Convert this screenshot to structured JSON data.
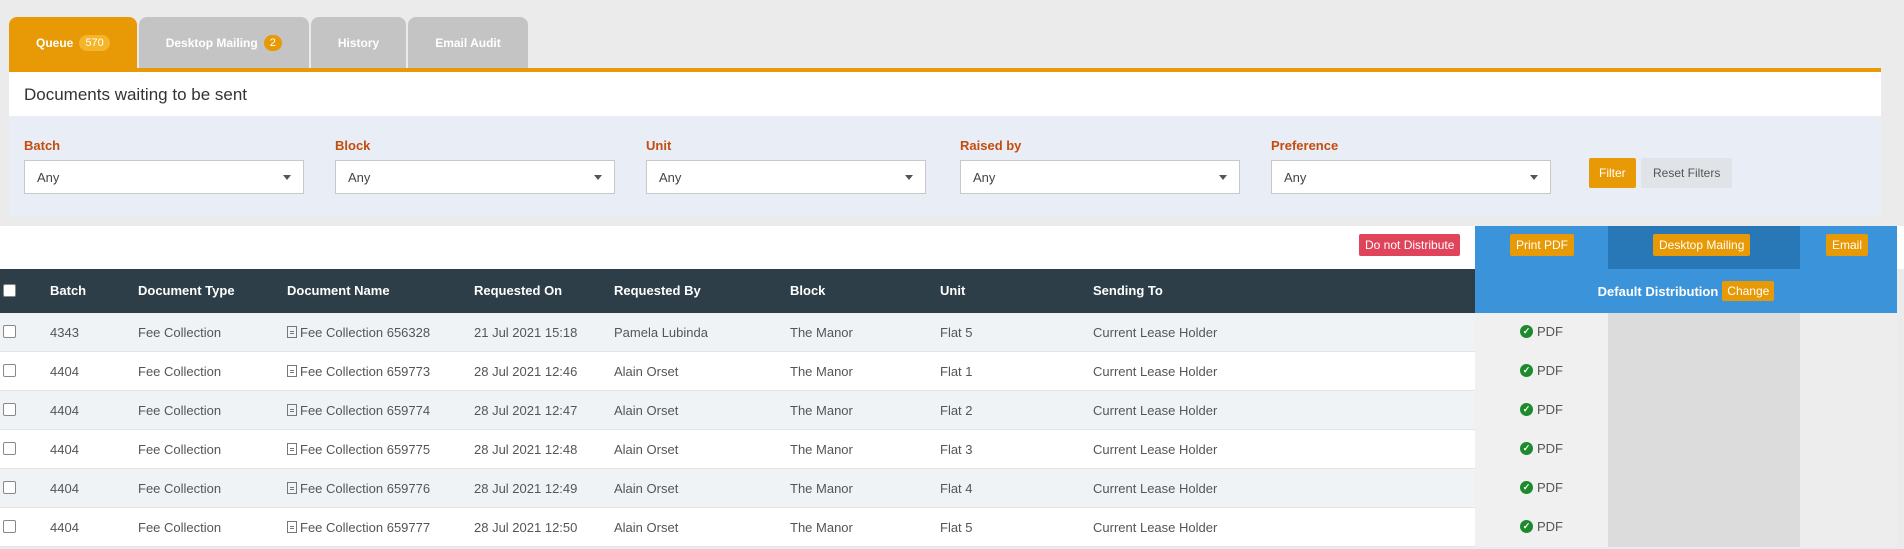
{
  "tabs": [
    {
      "label": "Queue",
      "badge": "570"
    },
    {
      "label": "Desktop Mailing",
      "badge": "2"
    },
    {
      "label": "History",
      "badge": ""
    },
    {
      "label": "Email Audit",
      "badge": ""
    }
  ],
  "panel_title": "Documents waiting to be sent",
  "filters": [
    {
      "label": "Batch",
      "value": "Any"
    },
    {
      "label": "Block",
      "value": "Any"
    },
    {
      "label": "Unit",
      "value": "Any"
    },
    {
      "label": "Raised by",
      "value": "Any"
    },
    {
      "label": "Preference",
      "value": "Any"
    }
  ],
  "filter_button": "Filter",
  "reset_button": "Reset Filters",
  "actions": {
    "do_not_distribute": "Do not Distribute",
    "print_pdf": "Print PDF",
    "desktop_mailing": "Desktop Mailing",
    "email": "Email"
  },
  "columns": {
    "batch": "Batch",
    "doc_type": "Document Type",
    "doc_name": "Document Name",
    "requested_on": "Requested On",
    "requested_by": "Requested By",
    "block": "Block",
    "unit": "Unit",
    "sending_to": "Sending To",
    "default_distribution": "Default Distribution",
    "change": "Change"
  },
  "rows": [
    {
      "batch": "4343",
      "doc_type": "Fee Collection",
      "doc_name": "Fee Collection 656328",
      "requested_on": "21 Jul 2021 15:18",
      "requested_by": "Pamela Lubinda",
      "block": "The Manor",
      "unit": "Flat 5",
      "sending_to": "Current Lease Holder",
      "distribution": "PDF"
    },
    {
      "batch": "4404",
      "doc_type": "Fee Collection",
      "doc_name": "Fee Collection 659773",
      "requested_on": "28 Jul 2021 12:46",
      "requested_by": "Alain Orset",
      "block": "The Manor",
      "unit": "Flat 1",
      "sending_to": "Current Lease Holder",
      "distribution": "PDF"
    },
    {
      "batch": "4404",
      "doc_type": "Fee Collection",
      "doc_name": "Fee Collection 659774",
      "requested_on": "28 Jul 2021 12:47",
      "requested_by": "Alain Orset",
      "block": "The Manor",
      "unit": "Flat 2",
      "sending_to": "Current Lease Holder",
      "distribution": "PDF"
    },
    {
      "batch": "4404",
      "doc_type": "Fee Collection",
      "doc_name": "Fee Collection 659775",
      "requested_on": "28 Jul 2021 12:48",
      "requested_by": "Alain Orset",
      "block": "The Manor",
      "unit": "Flat 3",
      "sending_to": "Current Lease Holder",
      "distribution": "PDF"
    },
    {
      "batch": "4404",
      "doc_type": "Fee Collection",
      "doc_name": "Fee Collection 659776",
      "requested_on": "28 Jul 2021 12:49",
      "requested_by": "Alain Orset",
      "block": "The Manor",
      "unit": "Flat 4",
      "sending_to": "Current Lease Holder",
      "distribution": "PDF"
    },
    {
      "batch": "4404",
      "doc_type": "Fee Collection",
      "doc_name": "Fee Collection 659777",
      "requested_on": "28 Jul 2021 12:50",
      "requested_by": "Alain Orset",
      "block": "The Manor",
      "unit": "Flat 5",
      "sending_to": "Current Lease Holder",
      "distribution": "PDF"
    }
  ]
}
